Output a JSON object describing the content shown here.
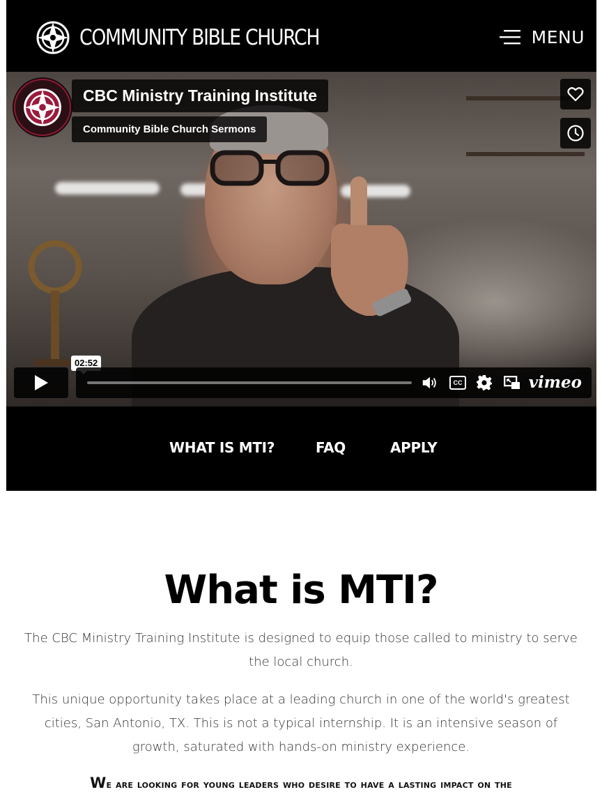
{
  "header": {
    "brand": "COMMUNITY BIBLE CHURCH",
    "menu_label": "MENU"
  },
  "video": {
    "title": "CBC Ministry Training Institute",
    "byline": "Community Bible Church Sermons",
    "time_tooltip": "02:52",
    "player_brand": "vimeo",
    "cc_label": "CC"
  },
  "subnav": {
    "items": [
      "WHAT IS MTI?",
      "FAQ",
      "APPLY"
    ]
  },
  "main": {
    "heading": "What is MTI?",
    "paragraph1": "The CBC Ministry Training Institute is designed to equip those called to ministry to serve the local church.",
    "paragraph2": "This unique opportunity takes place at a leading church in one of the world's greatest cities, San Antonio, TX. This is not a typical internship. It is an intensive season of growth, saturated with hands-on ministry experience.",
    "callout_first": "W",
    "callout_rest": "e are looking for young leaders who desire to have a lasting impact on the"
  },
  "colors": {
    "background": "#000000",
    "accent": "#8b1a35",
    "text": "#333333"
  },
  "icons": [
    "logo-icon",
    "menu-icon",
    "heart-icon",
    "clock-icon",
    "play-icon",
    "volume-icon",
    "cc-icon",
    "settings-icon",
    "pip-icon"
  ]
}
